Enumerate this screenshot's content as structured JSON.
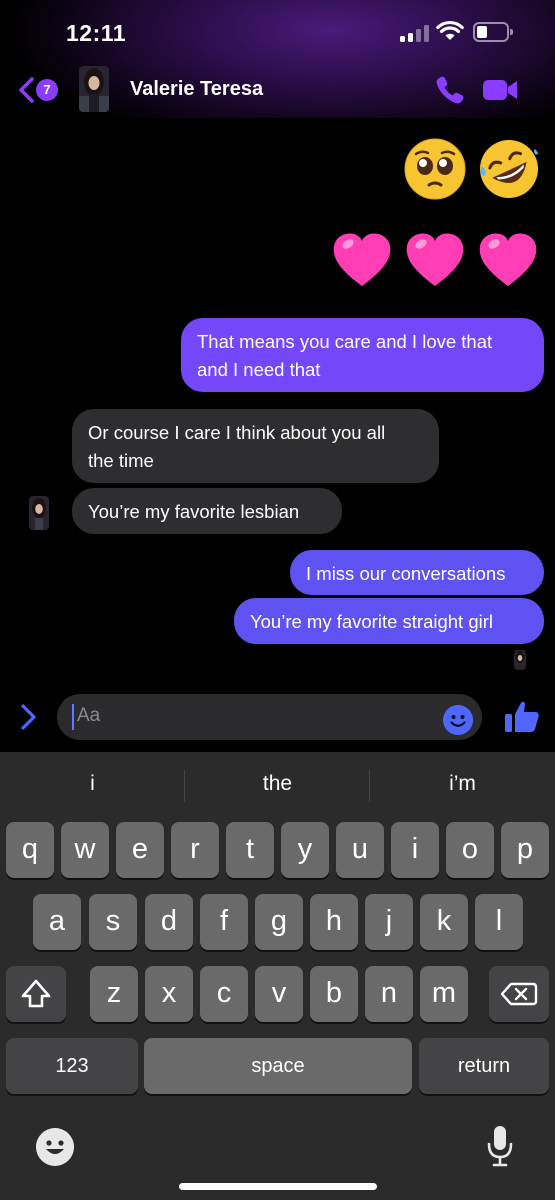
{
  "status_bar": {
    "time": "12:11"
  },
  "header": {
    "back_badge": "7",
    "contact_name": "Valerie Teresa"
  },
  "messages": {
    "reaction_emojis": [
      "pleading-face",
      "rolling-on-floor-laughing"
    ],
    "hearts": [
      "pink-heart",
      "pink-heart",
      "pink-heart"
    ],
    "out_1_line1": "That means you care and I love that",
    "out_1_line2": "and I need that",
    "in_1_line1": "Or course I care I think about you all",
    "in_1_line2": "the time",
    "in_2": "You’re my favorite lesbian",
    "out_2": "I miss our conversations",
    "out_3": "You’re my favorite straight girl"
  },
  "composer": {
    "placeholder": "Aa"
  },
  "keyboard": {
    "suggestions": [
      "i",
      "the",
      "i’m"
    ],
    "row1": [
      "q",
      "w",
      "e",
      "r",
      "t",
      "y",
      "u",
      "i",
      "o",
      "p"
    ],
    "row2": [
      "a",
      "s",
      "d",
      "f",
      "g",
      "h",
      "j",
      "k",
      "l"
    ],
    "row3": [
      "z",
      "x",
      "c",
      "v",
      "b",
      "n",
      "m"
    ],
    "numbers_label": "123",
    "space_label": "space",
    "return_label": "return"
  },
  "colors": {
    "accent_purple": "#8b3dff",
    "outgoing_bubble": "#7447f8",
    "outgoing_bubble_2": "#5e52f2",
    "incoming_bubble": "#2e2e30"
  }
}
